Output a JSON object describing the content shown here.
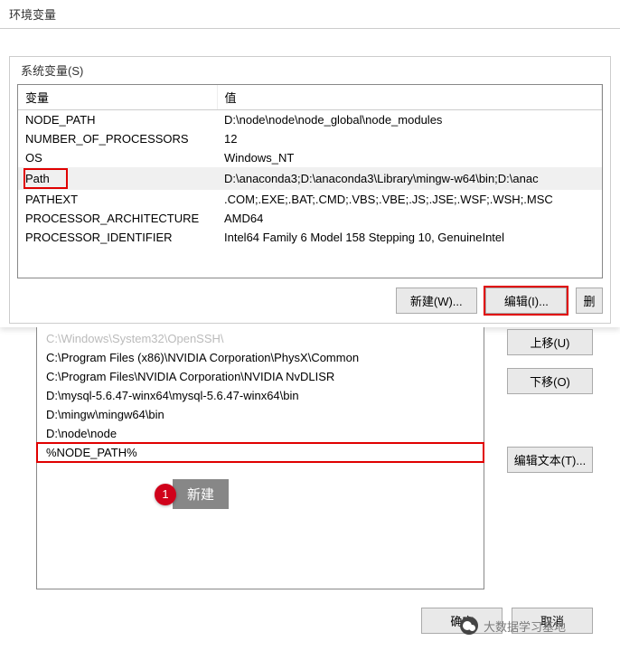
{
  "window": {
    "title": "环境变量"
  },
  "system_vars": {
    "legend": "系统变量(S)",
    "headers": {
      "name": "变量",
      "value": "值"
    },
    "rows": [
      {
        "name": "NODE_PATH",
        "value": "D:\\node\\node\\node_global\\node_modules"
      },
      {
        "name": "NUMBER_OF_PROCESSORS",
        "value": "12"
      },
      {
        "name": "OS",
        "value": "Windows_NT"
      },
      {
        "name": "Path",
        "value": "D:\\anaconda3;D:\\anaconda3\\Library\\mingw-w64\\bin;D:\\anac"
      },
      {
        "name": "PATHEXT",
        "value": ".COM;.EXE;.BAT;.CMD;.VBS;.VBE;.JS;.JSE;.WSF;.WSH;.MSC"
      },
      {
        "name": "PROCESSOR_ARCHITECTURE",
        "value": "AMD64"
      },
      {
        "name": "PROCESSOR_IDENTIFIER",
        "value": "Intel64 Family 6 Model 158 Stepping 10, GenuineIntel"
      }
    ],
    "buttons": {
      "new": "新建(W)...",
      "edit": "编辑(I)...",
      "delete": "删"
    }
  },
  "path_list": {
    "items": [
      "C:\\Windows\\System32\\OpenSSH\\",
      "C:\\Program Files (x86)\\NVIDIA Corporation\\PhysX\\Common",
      "C:\\Program Files\\NVIDIA Corporation\\NVIDIA NvDLISR",
      "D:\\mysql-5.6.47-winx64\\mysql-5.6.47-winx64\\bin",
      "D:\\mingw\\mingw64\\bin",
      "D:\\node\\node",
      "%NODE_PATH%"
    ],
    "side_buttons": {
      "move_up": "上移(U)",
      "move_down": "下移(O)",
      "edit_text": "编辑文本(T)..."
    }
  },
  "callout": {
    "number": "1",
    "label": "新建"
  },
  "dialog_buttons": {
    "ok": "确定",
    "cancel": "取消"
  },
  "watermark": {
    "text": "大数据学习基地"
  }
}
